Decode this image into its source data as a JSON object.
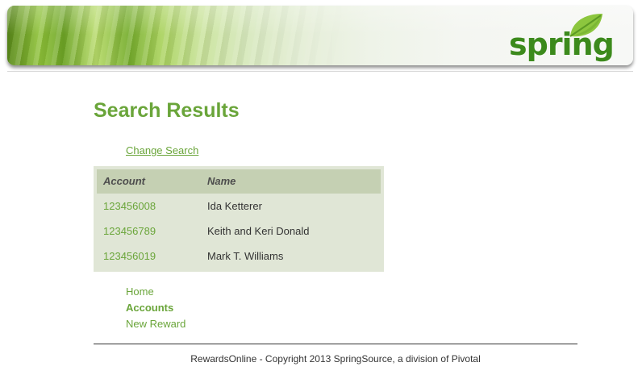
{
  "header": {
    "logo_text": "spring",
    "brand_color": "#3c8a1c"
  },
  "main": {
    "title": "Search Results",
    "change_search_label": "Change Search",
    "table": {
      "columns": [
        "Account",
        "Name"
      ],
      "rows": [
        {
          "account": "123456008",
          "name": "Ida Ketterer"
        },
        {
          "account": "123456789",
          "name": "Keith and Keri Donald"
        },
        {
          "account": "123456019",
          "name": "Mark T. Williams"
        }
      ]
    }
  },
  "nav": {
    "items": [
      {
        "label": "Home",
        "active": false
      },
      {
        "label": "Accounts",
        "active": true
      },
      {
        "label": "New Reward",
        "active": false
      }
    ]
  },
  "footer": {
    "text": "RewardsOnline - Copyright 2013 SpringSource, a division of Pivotal"
  },
  "colors": {
    "accent": "#6aa53a",
    "table_bg": "#e0e6d6",
    "table_header_bg": "#c5d0b3"
  }
}
